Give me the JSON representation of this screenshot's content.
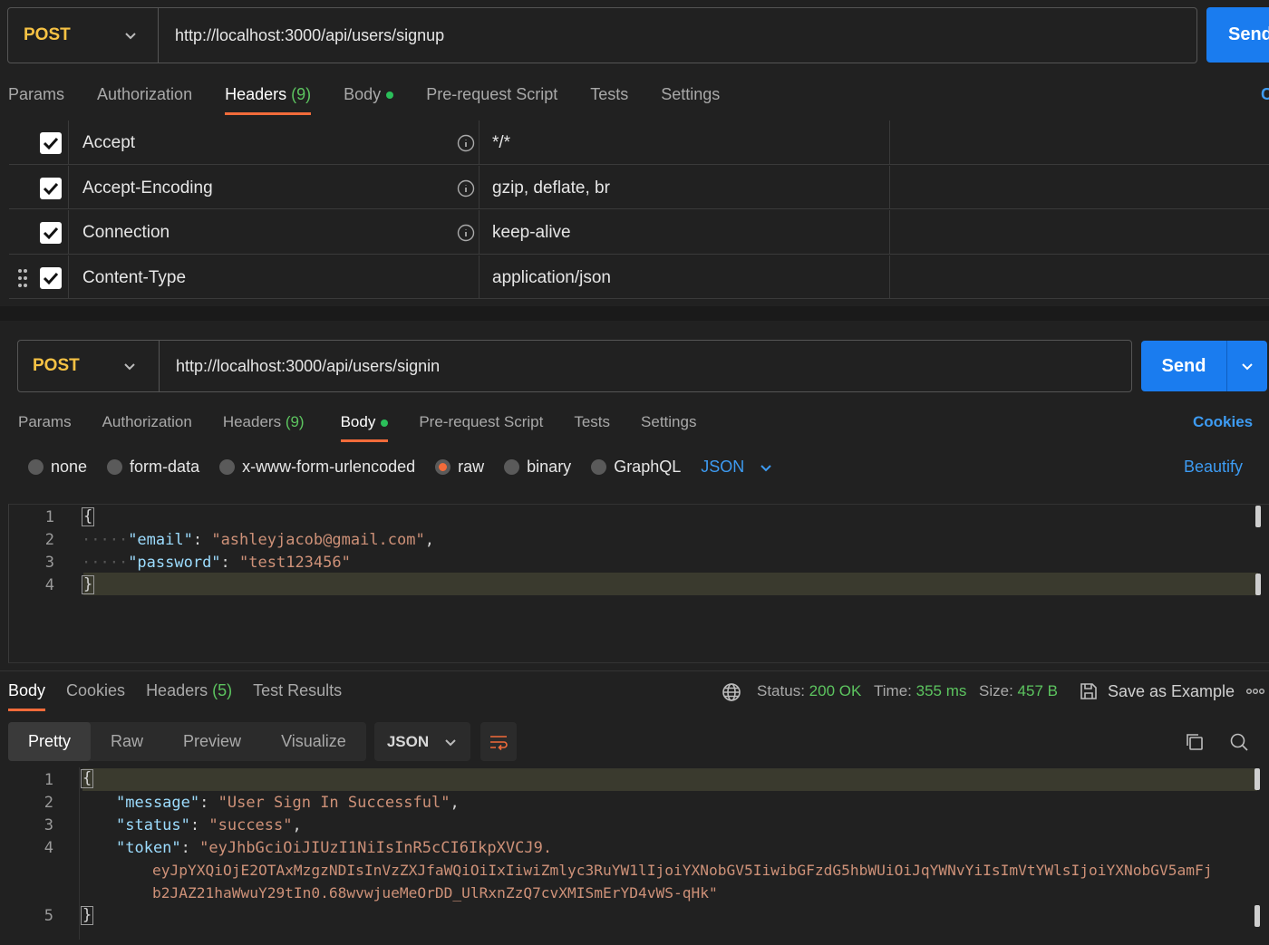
{
  "top_request": {
    "method": "POST",
    "url": "http://localhost:3000/api/users/signup",
    "send_label": "Send",
    "tabs": [
      {
        "label": "Params"
      },
      {
        "label": "Authorization"
      },
      {
        "label": "Headers",
        "count": "(9)"
      },
      {
        "label": "Body"
      },
      {
        "label": "Pre-request Script"
      },
      {
        "label": "Tests"
      },
      {
        "label": "Settings"
      }
    ],
    "headers": [
      {
        "key": "Accept",
        "value": "*/*"
      },
      {
        "key": "Accept-Encoding",
        "value": "gzip, deflate, br"
      },
      {
        "key": "Connection",
        "value": "keep-alive"
      },
      {
        "key": "Content-Type",
        "value": "application/json"
      }
    ]
  },
  "request": {
    "method": "POST",
    "url": "http://localhost:3000/api/users/signin",
    "send_label": "Send",
    "tabs": [
      {
        "label": "Params"
      },
      {
        "label": "Authorization"
      },
      {
        "label": "Headers",
        "count": "(9)"
      },
      {
        "label": "Body"
      },
      {
        "label": "Pre-request Script"
      },
      {
        "label": "Tests"
      },
      {
        "label": "Settings"
      }
    ],
    "cookies_label": "Cookies",
    "body_modes": [
      "none",
      "form-data",
      "x-www-form-urlencoded",
      "raw",
      "binary",
      "GraphQL"
    ],
    "selected_mode": "raw",
    "body_format": "JSON",
    "beautify_label": "Beautify",
    "line_numbers": [
      "1",
      "2",
      "3",
      "4"
    ],
    "body": {
      "open": "{",
      "close": "}",
      "email_key": "\"email\"",
      "email_value": "\"ashleyjacob@gmail.com\"",
      "password_key": "\"password\"",
      "password_value": "\"test123456\""
    }
  },
  "response": {
    "tabs": [
      {
        "label": "Body"
      },
      {
        "label": "Cookies"
      },
      {
        "label": "Headers",
        "count": "(5)"
      },
      {
        "label": "Test Results"
      }
    ],
    "status_label": "Status:",
    "status_value": "200 OK",
    "time_label": "Time:",
    "time_value": "355 ms",
    "size_label": "Size:",
    "size_value": "457 B",
    "save_label": "Save as Example",
    "view_modes": [
      "Pretty",
      "Raw",
      "Preview",
      "Visualize"
    ],
    "format": "JSON",
    "line_numbers": [
      "1",
      "2",
      "3",
      "4",
      "5"
    ],
    "body": {
      "open": "{",
      "close": "}",
      "message_key": "\"message\"",
      "message_value": "\"User Sign In Successful\"",
      "status_key": "\"status\"",
      "status_value": "\"success\"",
      "token_key": "\"token\"",
      "token_line1": "\"eyJhbGciOiJIUzI1NiIsInR5cCI6IkpXVCJ9.",
      "token_line2": "eyJpYXQiOjE2OTAxMzgzNDIsInVzZXJfaWQiOiIxIiwiZmlyc3RuYW1lIjoiYXNobGV5IiwibGFzdG5hbWUiOiJqYWNvYiIsImVtYWlsIjoiYXNobGV5amFj",
      "token_line3": "b2JAZ21haWwuY29tIn0.68wvwjueMeOrDD_UlRxnZzQ7cvXMISmErYD4vWS-qHk\""
    }
  },
  "colors": {
    "accent_orange": "#f26b3a",
    "send_blue": "#1a7cef",
    "method_yellow": "#f6c244",
    "status_green": "#5cc45f"
  }
}
